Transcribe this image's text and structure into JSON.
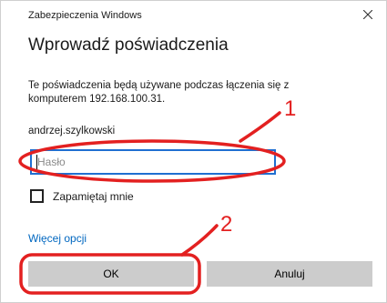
{
  "window": {
    "title": "Zabezpieczenia Windows"
  },
  "dialog": {
    "heading": "Wprowadź poświadczenia",
    "description": "Te poświadczenia będą używane podczas łączenia się z komputerem 192.168.100.31.",
    "username": "andrzej.szylkowski",
    "password": {
      "placeholder": "Hasło",
      "value": ""
    },
    "remember_label": "Zapamiętaj mnie",
    "remember_checked": false,
    "more_options": "Więcej opcji",
    "ok_label": "OK",
    "cancel_label": "Anuluj"
  },
  "annotations": {
    "marker1": "1",
    "marker2": "2",
    "color": "#e32020"
  },
  "colors": {
    "accent": "#1f6fd1",
    "link": "#0067c0",
    "button": "#cccccc"
  }
}
